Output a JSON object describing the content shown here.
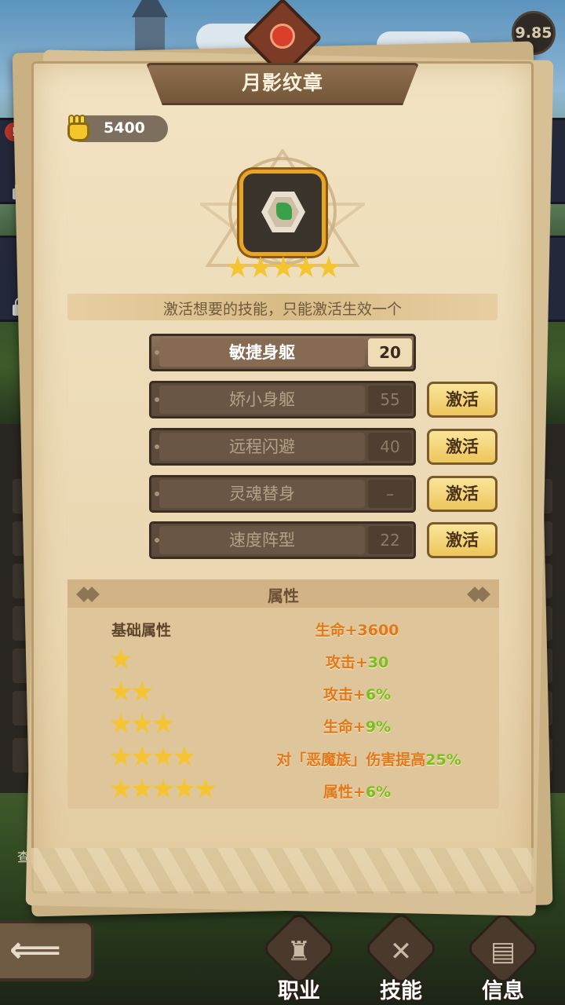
{
  "hud": {
    "timer": "9.85",
    "alert_mark": "!"
  },
  "title": "月影纹章",
  "currency": {
    "icon": "fist-icon",
    "value": "5400",
    "color": "#f3c72b"
  },
  "badge": {
    "icon": "emblem-gem-icon",
    "stars": 5
  },
  "info": "激活想要的技能，只能激活生效一个",
  "skills": [
    {
      "name": "敏捷身躯",
      "value": "20",
      "active": true,
      "button": ""
    },
    {
      "name": "娇小身躯",
      "value": "55",
      "active": false,
      "button": "激活"
    },
    {
      "name": "远程闪避",
      "value": "40",
      "active": false,
      "button": "激活"
    },
    {
      "name": "灵魂替身",
      "value": "–",
      "active": false,
      "button": "激活"
    },
    {
      "name": "速度阵型",
      "value": "22",
      "active": false,
      "button": "激活"
    }
  ],
  "attributes": {
    "title": "属性",
    "base_label": "基础属性",
    "rows": [
      {
        "stars": 0,
        "prefix": "生命+3600",
        "num": ""
      },
      {
        "stars": 1,
        "prefix": "攻击+",
        "num": "30"
      },
      {
        "stars": 2,
        "prefix": "攻击+",
        "num": "6%"
      },
      {
        "stars": 3,
        "prefix": "生命+",
        "num": "9%"
      },
      {
        "stars": 4,
        "prefix": "对「恶魔族」伤害提高",
        "num": "25%"
      },
      {
        "stars": 5,
        "prefix": "属性+",
        "num": "6%"
      }
    ],
    "value_color": "#e2781a",
    "highlight_color": "#7bbf1f"
  },
  "bottom_nav": {
    "back_icon": "back-arrow-icon",
    "left_text": "查",
    "items": [
      {
        "label": "职业",
        "icon": "chess-piece-icon"
      },
      {
        "label": "技能",
        "icon": "skill-rune-icon"
      },
      {
        "label": "信息",
        "icon": "document-icon"
      }
    ]
  }
}
